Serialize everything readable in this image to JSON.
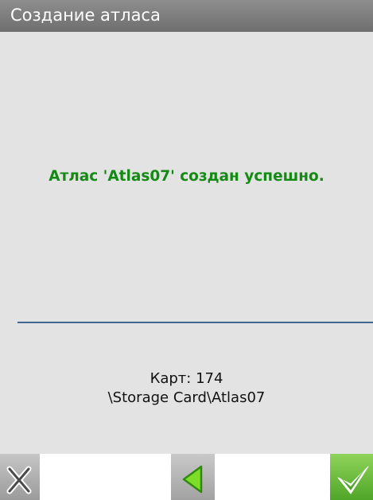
{
  "window": {
    "title": "Создание атласа"
  },
  "message": {
    "text": "Атлас 'Atlas07' создан успешно."
  },
  "info": {
    "maps_count": "Карт: 174",
    "path": "\\Storage Card\\Atlas07"
  },
  "toolbar": {
    "cancel_icon": "close-x-icon",
    "back_icon": "triangle-left-icon",
    "ok_icon": "checkmark-icon"
  },
  "colors": {
    "title_bar": "#7a7a7a",
    "background": "#e3e3e3",
    "message_text": "#138a13",
    "divider": "#3f6591",
    "ok_button": "#5cb030"
  }
}
